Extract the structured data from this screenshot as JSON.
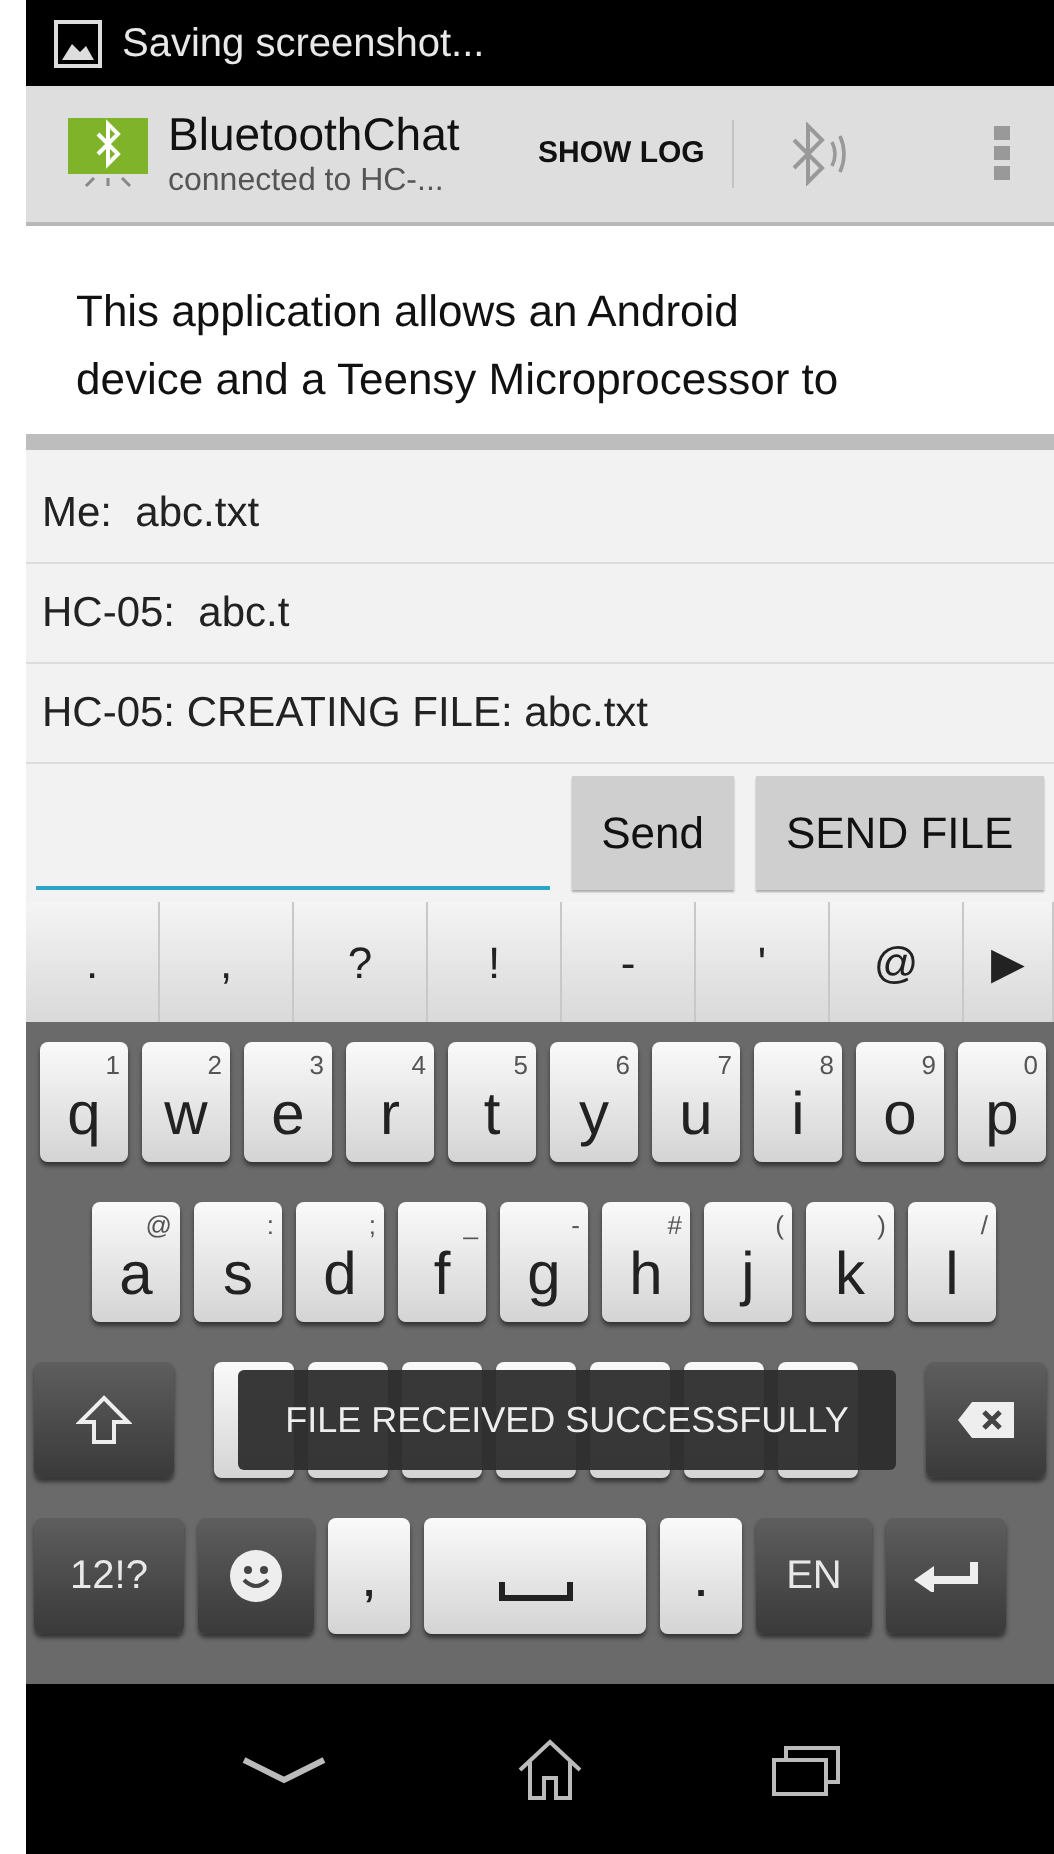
{
  "status_bar": {
    "notification": "Saving screenshot..."
  },
  "action_bar": {
    "title": "BluetoothChat",
    "subtitle": "connected to HC-...",
    "actions": [
      "SHOW LOG"
    ]
  },
  "intro": {
    "lines": [
      "This application allows an Android",
      "device and a Teensy Microprocessor to"
    ]
  },
  "messages": [
    {
      "text": "Me:  abc.txt"
    },
    {
      "text": "HC-05:  abc.t"
    },
    {
      "text": "HC-05: CREATING FILE: abc.txt"
    }
  ],
  "compose": {
    "buttons": [
      "Send",
      "SEND FILE"
    ]
  },
  "suggestions": [
    ".",
    ",",
    "?",
    "!",
    "-",
    "'",
    "@",
    "▶"
  ],
  "keyboard": {
    "row1": [
      {
        "key": "q",
        "hint": "1"
      },
      {
        "key": "w",
        "hint": "2"
      },
      {
        "key": "e",
        "hint": "3"
      },
      {
        "key": "r",
        "hint": "4"
      },
      {
        "key": "t",
        "hint": "5"
      },
      {
        "key": "y",
        "hint": "6"
      },
      {
        "key": "u",
        "hint": "7"
      },
      {
        "key": "i",
        "hint": "8"
      },
      {
        "key": "o",
        "hint": "9"
      },
      {
        "key": "p",
        "hint": "0"
      }
    ],
    "row2": [
      {
        "key": "a",
        "hint": "@"
      },
      {
        "key": "s",
        "hint": ":"
      },
      {
        "key": "d",
        "hint": ";"
      },
      {
        "key": "f",
        "hint": "_"
      },
      {
        "key": "g",
        "hint": "-"
      },
      {
        "key": "h",
        "hint": "#"
      },
      {
        "key": "j",
        "hint": "("
      },
      {
        "key": "k",
        "hint": ")"
      },
      {
        "key": "l",
        "hint": "/"
      }
    ],
    "row4": [
      {
        "kind": "text",
        "label": "12!?"
      },
      {
        "kind": "emoji"
      },
      {
        "kind": "char",
        "label": ","
      },
      {
        "kind": "space"
      },
      {
        "kind": "char",
        "label": "."
      },
      {
        "kind": "text",
        "label": "EN"
      },
      {
        "kind": "enter"
      }
    ]
  },
  "toast": {
    "text": "FILE RECEIVED SUCCESSFULLY"
  }
}
